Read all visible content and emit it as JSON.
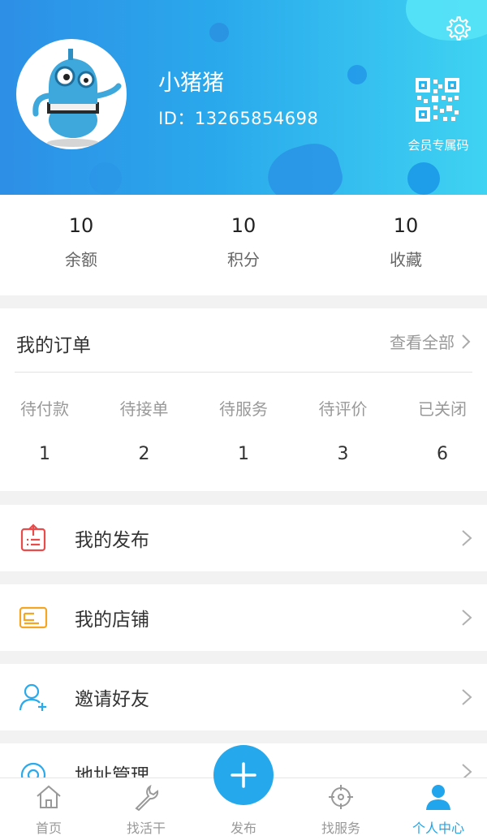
{
  "colors": {
    "accent": "#25a9ec",
    "header_start": "#2d8fe6",
    "header_end": "#3fd3f2"
  },
  "profile": {
    "username": "小猪猪",
    "id_label": "ID：",
    "id_value": "13265854698",
    "qr_label": "会员专属码"
  },
  "stats": [
    {
      "value": "10",
      "label": "余额"
    },
    {
      "value": "10",
      "label": "积分"
    },
    {
      "value": "10",
      "label": "收藏"
    }
  ],
  "orders": {
    "title": "我的订单",
    "view_all": "查看全部",
    "statuses": [
      {
        "label": "待付款",
        "count": "1"
      },
      {
        "label": "待接单",
        "count": "2"
      },
      {
        "label": "待服务",
        "count": "1"
      },
      {
        "label": "待评价",
        "count": "3"
      },
      {
        "label": "已关闭",
        "count": "6"
      }
    ]
  },
  "menu": [
    {
      "label": "我的发布",
      "icon": "upload-doc-icon"
    },
    {
      "label": "我的店铺",
      "icon": "card-icon"
    },
    {
      "label": "邀请好友",
      "icon": "add-user-icon"
    },
    {
      "label": "地址管理",
      "icon": "location-icon"
    }
  ],
  "tabs": [
    {
      "label": "首页",
      "icon": "home-icon"
    },
    {
      "label": "找活干",
      "icon": "wrench-icon"
    },
    {
      "label": "发布",
      "icon": "plus-icon"
    },
    {
      "label": "找服务",
      "icon": "crosshair-icon"
    },
    {
      "label": "个人中心",
      "icon": "user-icon",
      "active": true
    }
  ]
}
